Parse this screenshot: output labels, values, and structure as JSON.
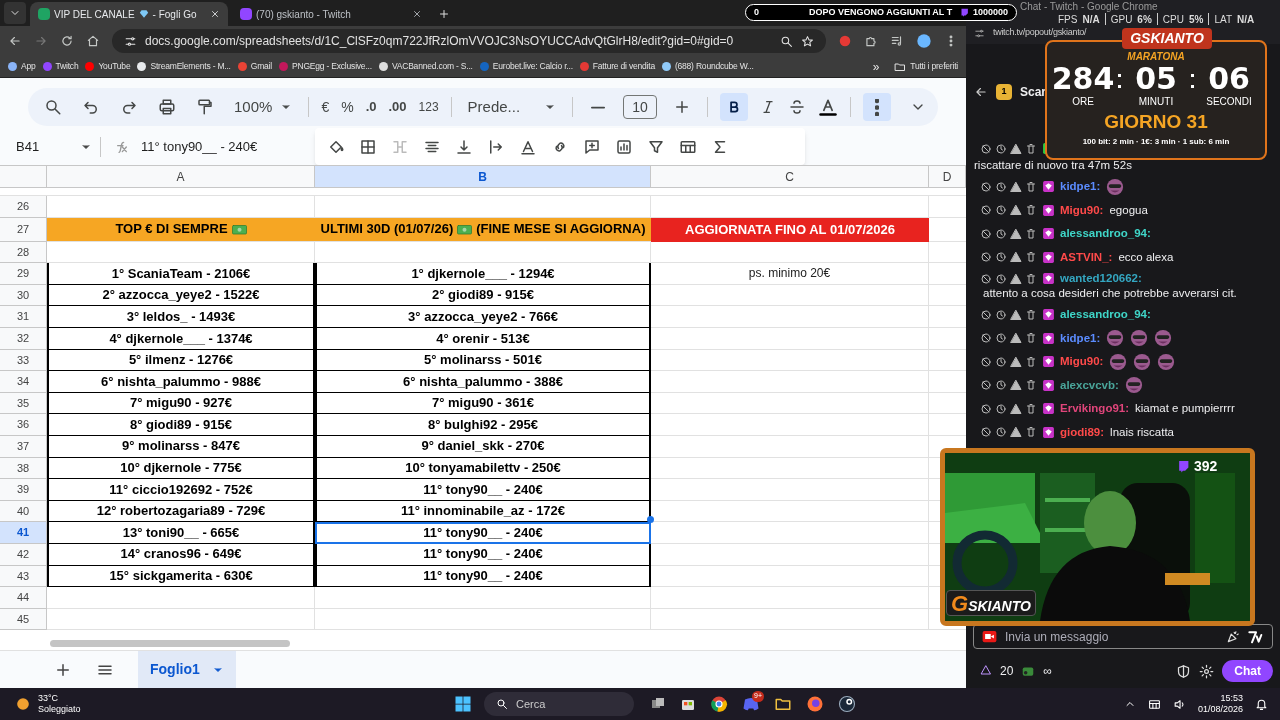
{
  "browser": {
    "tabs": [
      {
        "title": "VIP DEL CANALE",
        "suffix": "- Fogli Go",
        "selected": true,
        "color": "#1fa463"
      },
      {
        "title": "(70) gskianto - Twitch",
        "selected": false,
        "color": "#9146ff"
      }
    ],
    "url": "docs.google.com/spreadsheets/d/1C_ClSFz0qm722JfRzlOmVVOJC3NsOYUCCAdvQtGlrH8/edit?gid=0#gid=0",
    "bookmarks": [
      {
        "label": "App",
        "color": "#8ab4f8"
      },
      {
        "label": "Twitch",
        "color": "#9146ff"
      },
      {
        "label": "YouTube",
        "color": "#ff0000"
      },
      {
        "label": "StreamElements - M...",
        "color": "#e8eaed"
      },
      {
        "label": "Gmail",
        "color": "#ea4335"
      },
      {
        "label": "PNGEgg - Exclusive...",
        "color": "#c2185b"
      },
      {
        "label": "VACBanned.com - S...",
        "color": "#dddddd"
      },
      {
        "label": "Eurobet.live: Calcio r...",
        "color": "#1565c0"
      },
      {
        "label": "Fatture di vendita",
        "color": "#e53935"
      },
      {
        "label": "(688) Roundcube W...",
        "color": "#90caf9"
      }
    ],
    "more": "»",
    "all_bookmarks": "Tutti i preferiti"
  },
  "sheets": {
    "toolbar": {
      "zoom": "100%",
      "currency": "€",
      "percent": "%",
      "decrease_decimals": ".0",
      "increase_decimals": ".00",
      "number_format": "123",
      "font": "Prede...",
      "font_size": "10",
      "bold": true,
      "more_open": true
    },
    "name_box": "B41",
    "formula": "11° tony90__ - 240€",
    "columns": [
      {
        "label": "A",
        "selected": false
      },
      {
        "label": "B",
        "selected": true
      },
      {
        "label": "C",
        "selected": false
      },
      {
        "label": "D",
        "selected": false
      }
    ],
    "rows": [
      {
        "number": "26",
        "selected": false
      },
      {
        "number": "27",
        "selected": false,
        "cells": {
          "a": {
            "parts": [
              "TOP € DI SEMPRE"
            ],
            "kind": "orange_header",
            "selected": false
          },
          "b": {
            "parts": [
              "ULTIMI 30D (01/07/26)",
              "(FINE MESE SI AGGIORNA)"
            ],
            "kind": "orange_header",
            "selected": false
          },
          "c": {
            "parts": [
              "AGGIORNATA FINO AL  01/07/2026"
            ],
            "kind": "red_header",
            "selected": false
          }
        }
      },
      {
        "number": "28",
        "selected": false
      },
      {
        "number": "29",
        "selected": false,
        "cells": {
          "a": {
            "text": "1° ScaniaTeam - 2106€",
            "kind": "ranked",
            "selected": false
          },
          "b": {
            "text": "1° djkernole___ - 1294€",
            "kind": "ranked",
            "selected": false
          },
          "c": {
            "text": "ps. minimo 20€",
            "kind": "note",
            "selected": false
          }
        }
      },
      {
        "number": "30",
        "selected": false,
        "cells": {
          "a": {
            "text": "2° azzocca_yeye2 - 1522€",
            "kind": "ranked",
            "selected": false
          },
          "b": {
            "text": "2° giodi89 - 915€",
            "kind": "ranked",
            "selected": false
          }
        }
      },
      {
        "number": "31",
        "selected": false,
        "cells": {
          "a": {
            "text": "3° leldos_ - 1493€",
            "kind": "ranked",
            "selected": false
          },
          "b": {
            "text": "3° azzocca_yeye2 - 766€",
            "kind": "ranked",
            "selected": false
          }
        }
      },
      {
        "number": "32",
        "selected": false,
        "cells": {
          "a": {
            "text": "4° djkernole___ - 1374€",
            "kind": "ranked",
            "selected": false
          },
          "b": {
            "text": "4° orenir - 513€",
            "kind": "ranked",
            "selected": false
          }
        }
      },
      {
        "number": "33",
        "selected": false,
        "cells": {
          "a": {
            "text": "5° ilmenz - 1276€",
            "kind": "ranked",
            "selected": false
          },
          "b": {
            "text": "5° molinarss - 501€",
            "kind": "ranked",
            "selected": false
          }
        }
      },
      {
        "number": "34",
        "selected": false,
        "cells": {
          "a": {
            "text": "6° nishta_palummo - 988€",
            "kind": "ranked",
            "selected": false
          },
          "b": {
            "text": "6° nishta_palummo - 388€",
            "kind": "ranked",
            "selected": false
          }
        }
      },
      {
        "number": "35",
        "selected": false,
        "cells": {
          "a": {
            "text": "7° migu90 - 927€",
            "kind": "ranked",
            "selected": false
          },
          "b": {
            "text": "7° migu90 - 361€",
            "kind": "ranked",
            "selected": false
          }
        }
      },
      {
        "number": "36",
        "selected": false,
        "cells": {
          "a": {
            "text": "8° giodi89 - 915€",
            "kind": "ranked",
            "selected": false
          },
          "b": {
            "text": "8° bulghi92 - 295€",
            "kind": "ranked",
            "selected": false
          }
        }
      },
      {
        "number": "37",
        "selected": false,
        "cells": {
          "a": {
            "text": "9° molinarss - 847€",
            "kind": "ranked",
            "selected": false
          },
          "b": {
            "text": "9° daniel_skk - 270€",
            "kind": "ranked",
            "selected": false
          }
        }
      },
      {
        "number": "38",
        "selected": false,
        "cells": {
          "a": {
            "text": "10° djkernole - 775€",
            "kind": "ranked",
            "selected": false
          },
          "b": {
            "text": "10° tonyamabilettv - 250€",
            "kind": "ranked",
            "selected": false
          }
        }
      },
      {
        "number": "39",
        "selected": false,
        "cells": {
          "a": {
            "text": "11° ciccio192692 - 752€",
            "kind": "ranked",
            "selected": false
          },
          "b": {
            "text": "11° tony90__ - 240€",
            "kind": "ranked",
            "selected": false
          }
        }
      },
      {
        "number": "40",
        "selected": false,
        "cells": {
          "a": {
            "text": "12° robertozagaria89 - 729€",
            "kind": "ranked",
            "selected": false
          },
          "b": {
            "text": "11° innominabile_az - 172€",
            "kind": "ranked",
            "selected": false
          }
        }
      },
      {
        "number": "41",
        "selected": true,
        "cells": {
          "a": {
            "text": "13° toni90__ - 665€",
            "kind": "ranked",
            "selected": false
          },
          "b": {
            "text": "11° tony90__ - 240€",
            "kind": "ranked",
            "selected": true
          }
        }
      },
      {
        "number": "42",
        "selected": false,
        "cells": {
          "a": {
            "text": "14° cranos96 - 649€",
            "kind": "ranked",
            "selected": false
          },
          "b": {
            "text": "11° tony90__ - 240€",
            "kind": "ranked",
            "selected": false
          }
        }
      },
      {
        "number": "43",
        "selected": false,
        "cells": {
          "a": {
            "text": "15° sickgamerita - 630€",
            "kind": "ranked",
            "selected": false
          },
          "b": {
            "text": "11° tony90__ - 240€",
            "kind": "ranked",
            "selected": false
          }
        }
      },
      {
        "number": "44",
        "selected": false
      },
      {
        "number": "45",
        "selected": false
      }
    ],
    "sheet_tabs": [
      {
        "label": "Foglio1",
        "selected": true
      }
    ]
  },
  "chat": {
    "window_title": "Chat - Twitch - Google Chrome",
    "url": "twitch.tv/popout/gskianto/",
    "pinned_name": "Scar",
    "gift_count": "1",
    "messages": [
      {
        "kind": "wrapped",
        "text": "riscattare di nuovo tra 47m 52s"
      },
      {
        "kind": "message",
        "user": "kidpe1:",
        "color": "#5b8cff"
      },
      {
        "kind": "message",
        "user": "Migu90:",
        "color": "#ff4a4a",
        "text": "egogua"
      },
      {
        "kind": "message",
        "user": "alessandroo_94:",
        "color": "#3fd6c8"
      },
      {
        "kind": "message",
        "user": "ASTVIN_:",
        "color": "#ff4a4a",
        "text": "ecco alexa"
      },
      {
        "kind": "message",
        "user": "wanted120662:",
        "color": "#34a7c2",
        "text": "attento a cosa desideri che potrebbe avverarsi cit."
      },
      {
        "kind": "message",
        "user": "alessandroo_94:",
        "color": "#3fd6c8"
      },
      {
        "kind": "message",
        "user": "kidpe1:",
        "color": "#5b8cff"
      },
      {
        "kind": "message",
        "user": "Migu90:",
        "color": "#ff4a4a"
      },
      {
        "kind": "message",
        "user": "alexcvcvb:",
        "color": "#4aa59a"
      },
      {
        "kind": "message",
        "user": "Ervikingo91:",
        "color": "#e0457b",
        "text": "kiamat e pumpierrrr"
      },
      {
        "kind": "message",
        "user": "giodi89:",
        "color": "#ff4a4a",
        "text": "lnais riscatta"
      }
    ],
    "input_placeholder": "Invia un messaggio",
    "points": "20",
    "infinity": "∞",
    "send": "Chat"
  },
  "overlays": {
    "goal_start": "0",
    "goal_text": "DOPO VENGONO AGGIUNTI AL T",
    "goal_end": "1000000",
    "stats": [
      {
        "label": "FPS",
        "value": "N/A"
      },
      {
        "label": "GPU",
        "value": "6%"
      },
      {
        "label": "CPU",
        "value": "5%"
      },
      {
        "label": "LAT",
        "value": "N/A"
      }
    ],
    "timer": {
      "logo": "GSKIANTO",
      "subtitle": "MARATONA",
      "units": [
        {
          "value": "284",
          "label": "ORE"
        },
        {
          "value": "05",
          "label": "MINUTI"
        },
        {
          "value": "06",
          "label": "SECONDI"
        }
      ],
      "day": "GIORNO 31",
      "rates": "100 bit: 2 min · 1€: 3 min · 1 sub: 6 min"
    },
    "viewers": "392",
    "cam_logo_initial": "G",
    "cam_logo": "SKIANTO"
  },
  "taskbar": {
    "temperature": "33°C",
    "weather": "Soleggiato",
    "search_placeholder": "Cerca",
    "discord_badge": "9+",
    "time": "15:53",
    "date": "01/08/2026"
  }
}
